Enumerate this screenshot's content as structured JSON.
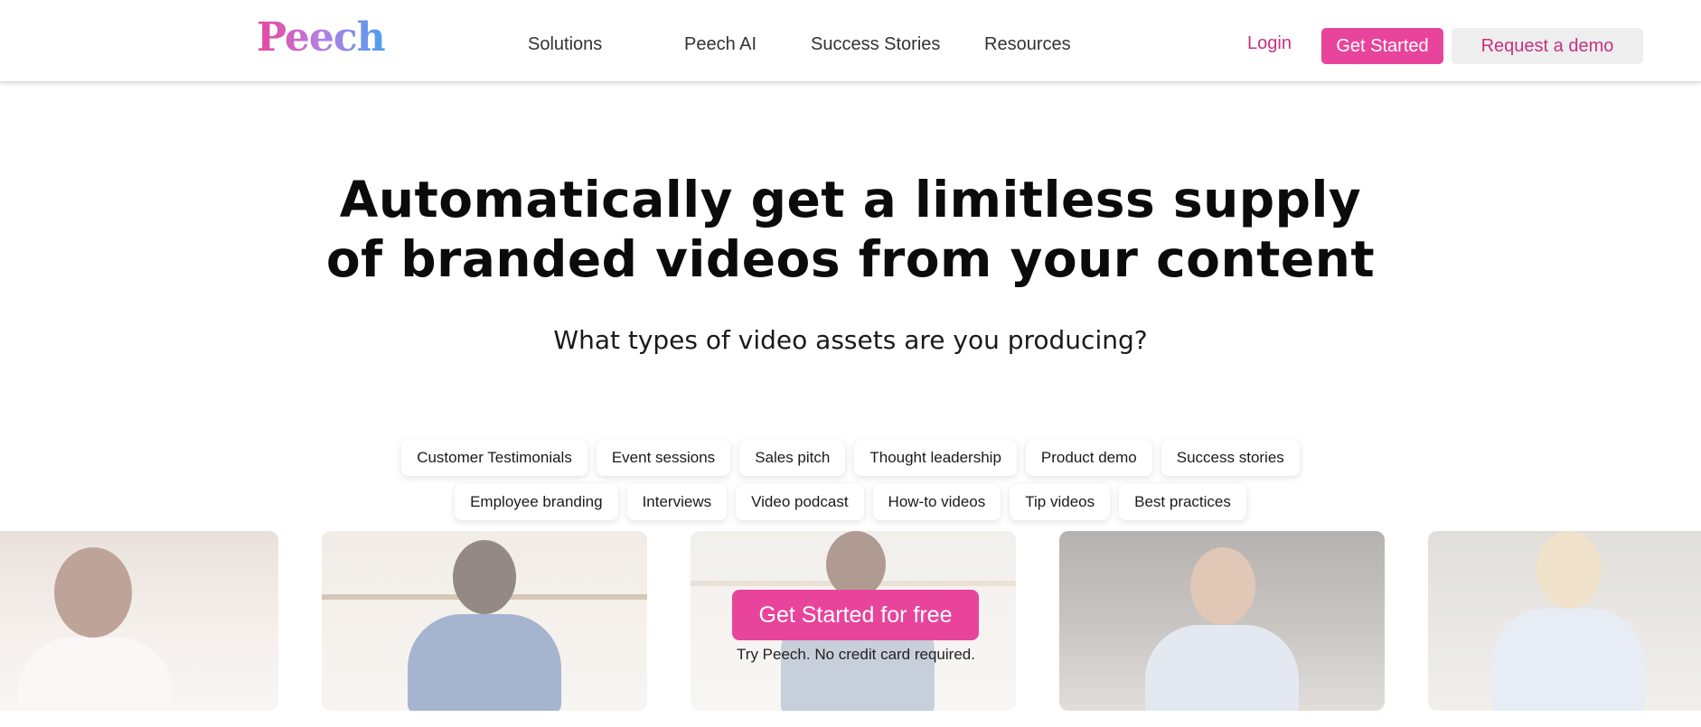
{
  "header": {
    "logo_text": "Peech",
    "nav": [
      {
        "label": "Solutions"
      },
      {
        "label": "Peech AI"
      },
      {
        "label": "Success Stories"
      },
      {
        "label": "Resources"
      }
    ],
    "login_label": "Login",
    "get_started_label": "Get Started",
    "request_demo_label": "Request a demo"
  },
  "hero": {
    "headline_line1": "Automatically get a limitless supply",
    "headline_line2": "of branded videos from your content",
    "subheadline": "What types of video assets are you producing?"
  },
  "chips": {
    "row1": [
      "Customer Testimonials",
      "Event sessions",
      "Sales pitch",
      "Thought leadership",
      "Product demo",
      "Success stories"
    ],
    "row2": [
      "Employee branding",
      "Interviews",
      "Video podcast",
      "How-to videos",
      "Tip videos",
      "Best practices"
    ]
  },
  "cta": {
    "button_label": "Get Started for free",
    "note": "Try Peech. No credit card required."
  },
  "colors": {
    "brand_pink": "#e8449b",
    "link_pink": "#c5337f",
    "demo_bg": "#eeeeef"
  }
}
